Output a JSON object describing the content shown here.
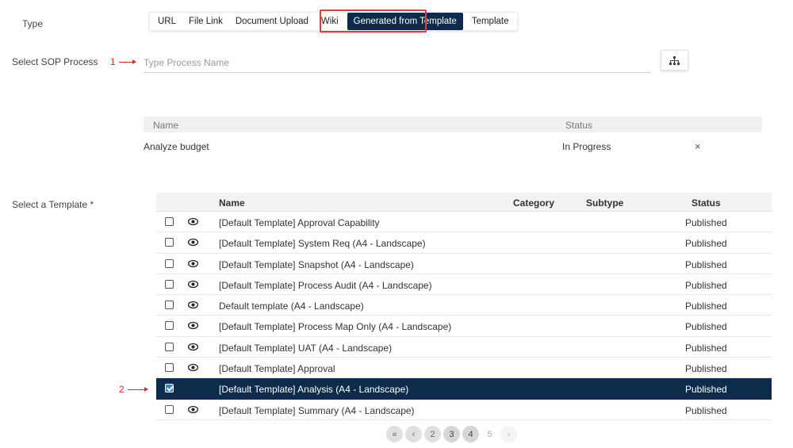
{
  "type_section": {
    "label": "Type",
    "tabs": [
      {
        "label": "URL",
        "active": false
      },
      {
        "label": "File Link",
        "active": false
      },
      {
        "label": "Document Upload",
        "active": false
      },
      {
        "label": "Wiki",
        "active": false
      },
      {
        "label": "Generated from Template",
        "active": true
      },
      {
        "label": "Template",
        "active": false
      }
    ]
  },
  "sop_section": {
    "label": "Select SOP Process",
    "annotation": "1",
    "input_placeholder": "Type Process Name",
    "input_value": "",
    "tree_button_icon": "sitemap-icon"
  },
  "process_table": {
    "headers": {
      "name": "Name",
      "status": "Status"
    },
    "rows": [
      {
        "name": "Analyze budget",
        "status": "In Progress",
        "remove_icon": "×"
      }
    ]
  },
  "template_section": {
    "label": "Select a Template *",
    "annotation": "2",
    "headers": {
      "name": "Name",
      "category": "Category",
      "subtype": "Subtype",
      "status": "Status"
    },
    "rows": [
      {
        "name": "[Default Template] Approval Capability",
        "category": "",
        "subtype": "",
        "status": "Published",
        "checked": false
      },
      {
        "name": "[Default Template] System Req (A4 - Landscape)",
        "category": "",
        "subtype": "",
        "status": "Published",
        "checked": false
      },
      {
        "name": "[Default Template] Snapshot (A4 - Landscape)",
        "category": "",
        "subtype": "",
        "status": "Published",
        "checked": false
      },
      {
        "name": "[Default Template] Process Audit (A4 - Landscape)",
        "category": "",
        "subtype": "",
        "status": "Published",
        "checked": false
      },
      {
        "name": "Default template (A4 - Landscape)",
        "category": "",
        "subtype": "",
        "status": "Published",
        "checked": false
      },
      {
        "name": "[Default Template] Process Map Only (A4 - Landscape)",
        "category": "",
        "subtype": "",
        "status": "Published",
        "checked": false
      },
      {
        "name": "[Default Template] UAT (A4 - Landscape)",
        "category": "",
        "subtype": "",
        "status": "Published",
        "checked": false
      },
      {
        "name": "[Default Template] Approval",
        "category": "",
        "subtype": "",
        "status": "Published",
        "checked": false
      },
      {
        "name": "[Default Template] Analysis (A4 - Landscape)",
        "category": "",
        "subtype": "",
        "status": "Published",
        "checked": true
      },
      {
        "name": "[Default Template] Summary (A4 - Landscape)",
        "category": "",
        "subtype": "",
        "status": "Published",
        "checked": false
      }
    ]
  },
  "pagination": {
    "first": "«",
    "prev": "‹",
    "pages": [
      "2",
      "3",
      "4",
      "5"
    ],
    "next": "›"
  },
  "colors": {
    "accent": "#0d2b4a",
    "highlight": "#e53935",
    "annotation": "#d32f2f",
    "checkbox_checked": "#1e88e5"
  }
}
